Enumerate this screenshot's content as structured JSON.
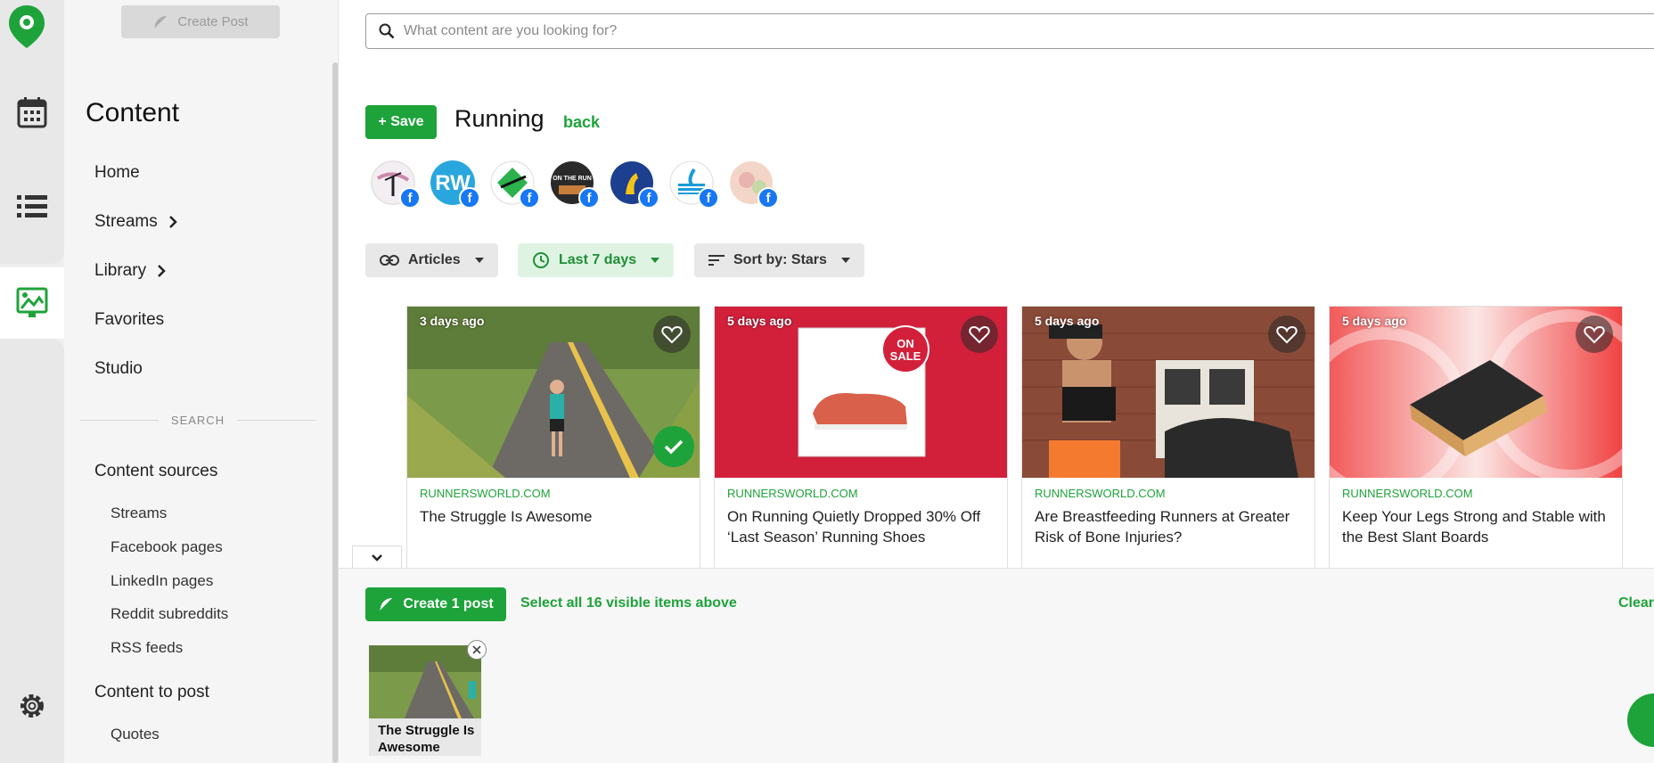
{
  "sidebar": {
    "create_post_top": "Create Post",
    "heading": "Content",
    "nav": [
      {
        "label": "Home",
        "has_chevron": false
      },
      {
        "label": "Streams",
        "has_chevron": true
      },
      {
        "label": "Library",
        "has_chevron": true
      },
      {
        "label": "Favorites",
        "has_chevron": false
      },
      {
        "label": "Studio",
        "has_chevron": false
      }
    ],
    "section_label": "SEARCH",
    "content_sources_heading": "Content sources",
    "content_sources": [
      "Streams",
      "Facebook pages",
      "LinkedIn pages",
      "Reddit subreddits",
      "RSS feeds"
    ],
    "content_to_post_heading": "Content to post",
    "content_to_post": [
      "Quotes"
    ]
  },
  "search": {
    "placeholder": "What content are you looking for?"
  },
  "header": {
    "save_label": "+ Save",
    "title": "Running",
    "back_label": "back"
  },
  "filters": {
    "type": "Articles",
    "period": "Last 7 days",
    "sort": "Sort by: Stars"
  },
  "cards": [
    {
      "ago": "3 days ago",
      "source": "RUNNERSWORLD.COM",
      "title": "The Struggle Is Awesome",
      "selected": true
    },
    {
      "ago": "5 days ago",
      "source": "RUNNERSWORLD.COM",
      "title": "On Running Quietly Dropped 30% Off ‘Last Season’ Running Shoes",
      "selected": false,
      "badge_line1": "ON",
      "badge_line2": "SALE"
    },
    {
      "ago": "5 days ago",
      "source": "RUNNERSWORLD.COM",
      "title": "Are Breastfeeding Runners at Greater Risk of Bone Injuries?",
      "selected": false
    },
    {
      "ago": "5 days ago",
      "source": "RUNNERSWORLD.COM",
      "title": "Keep Your Legs Strong and Stable with the Best Slant Boards",
      "selected": false
    }
  ],
  "tray": {
    "create_label": "Create 1 post",
    "select_all_label": "Select all 16 visible items above",
    "clear_label": "Clear",
    "selected_title": "The Struggle Is Awesome"
  },
  "avatar_texts": {
    "rw": "RW",
    "on_the_run": "ON THE RUN"
  },
  "colors": {
    "accent": "#1ea33a",
    "facebook": "#1877f2"
  }
}
